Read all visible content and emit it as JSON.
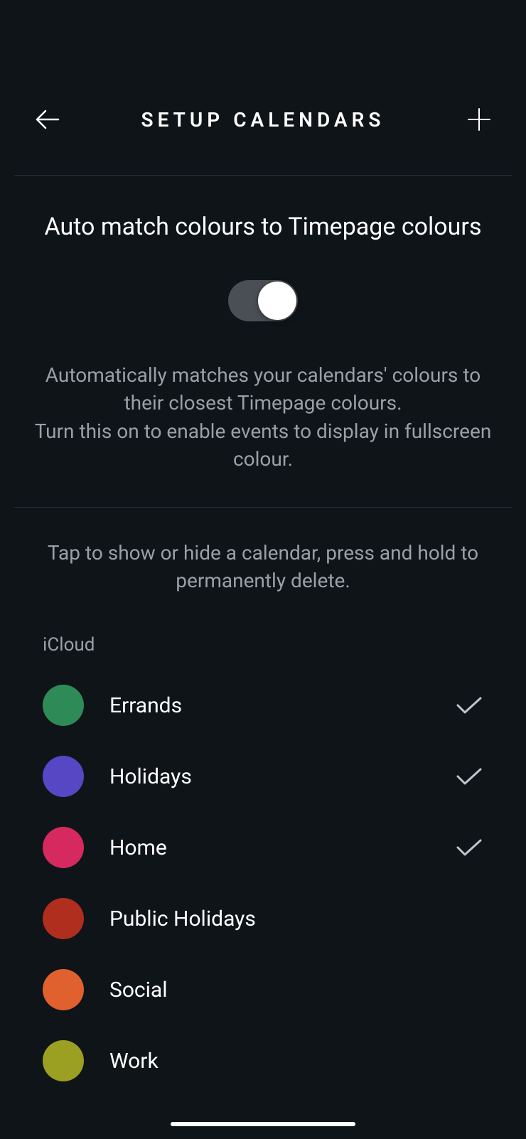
{
  "header": {
    "title": "SETUP CALENDARS"
  },
  "auto_match": {
    "title": "Auto match colours to Timepage colours",
    "enabled": true,
    "description": "Automatically matches your calendars' colours to their closest Timepage colours.\nTurn this on to enable events to display in fullscreen colour."
  },
  "instruction": "Tap to show or hide a calendar, press and hold to permanently delete.",
  "calendar_group": {
    "title": "iCloud",
    "items": [
      {
        "name": "Errands",
        "color": "#2e8b57",
        "checked": true
      },
      {
        "name": "Holidays",
        "color": "#5847c4",
        "checked": true
      },
      {
        "name": "Home",
        "color": "#d6295f",
        "checked": true
      },
      {
        "name": "Public Holidays",
        "color": "#b02e1e",
        "checked": false
      },
      {
        "name": "Social",
        "color": "#e0612e",
        "checked": false
      },
      {
        "name": "Work",
        "color": "#9ba023",
        "checked": false
      }
    ]
  }
}
